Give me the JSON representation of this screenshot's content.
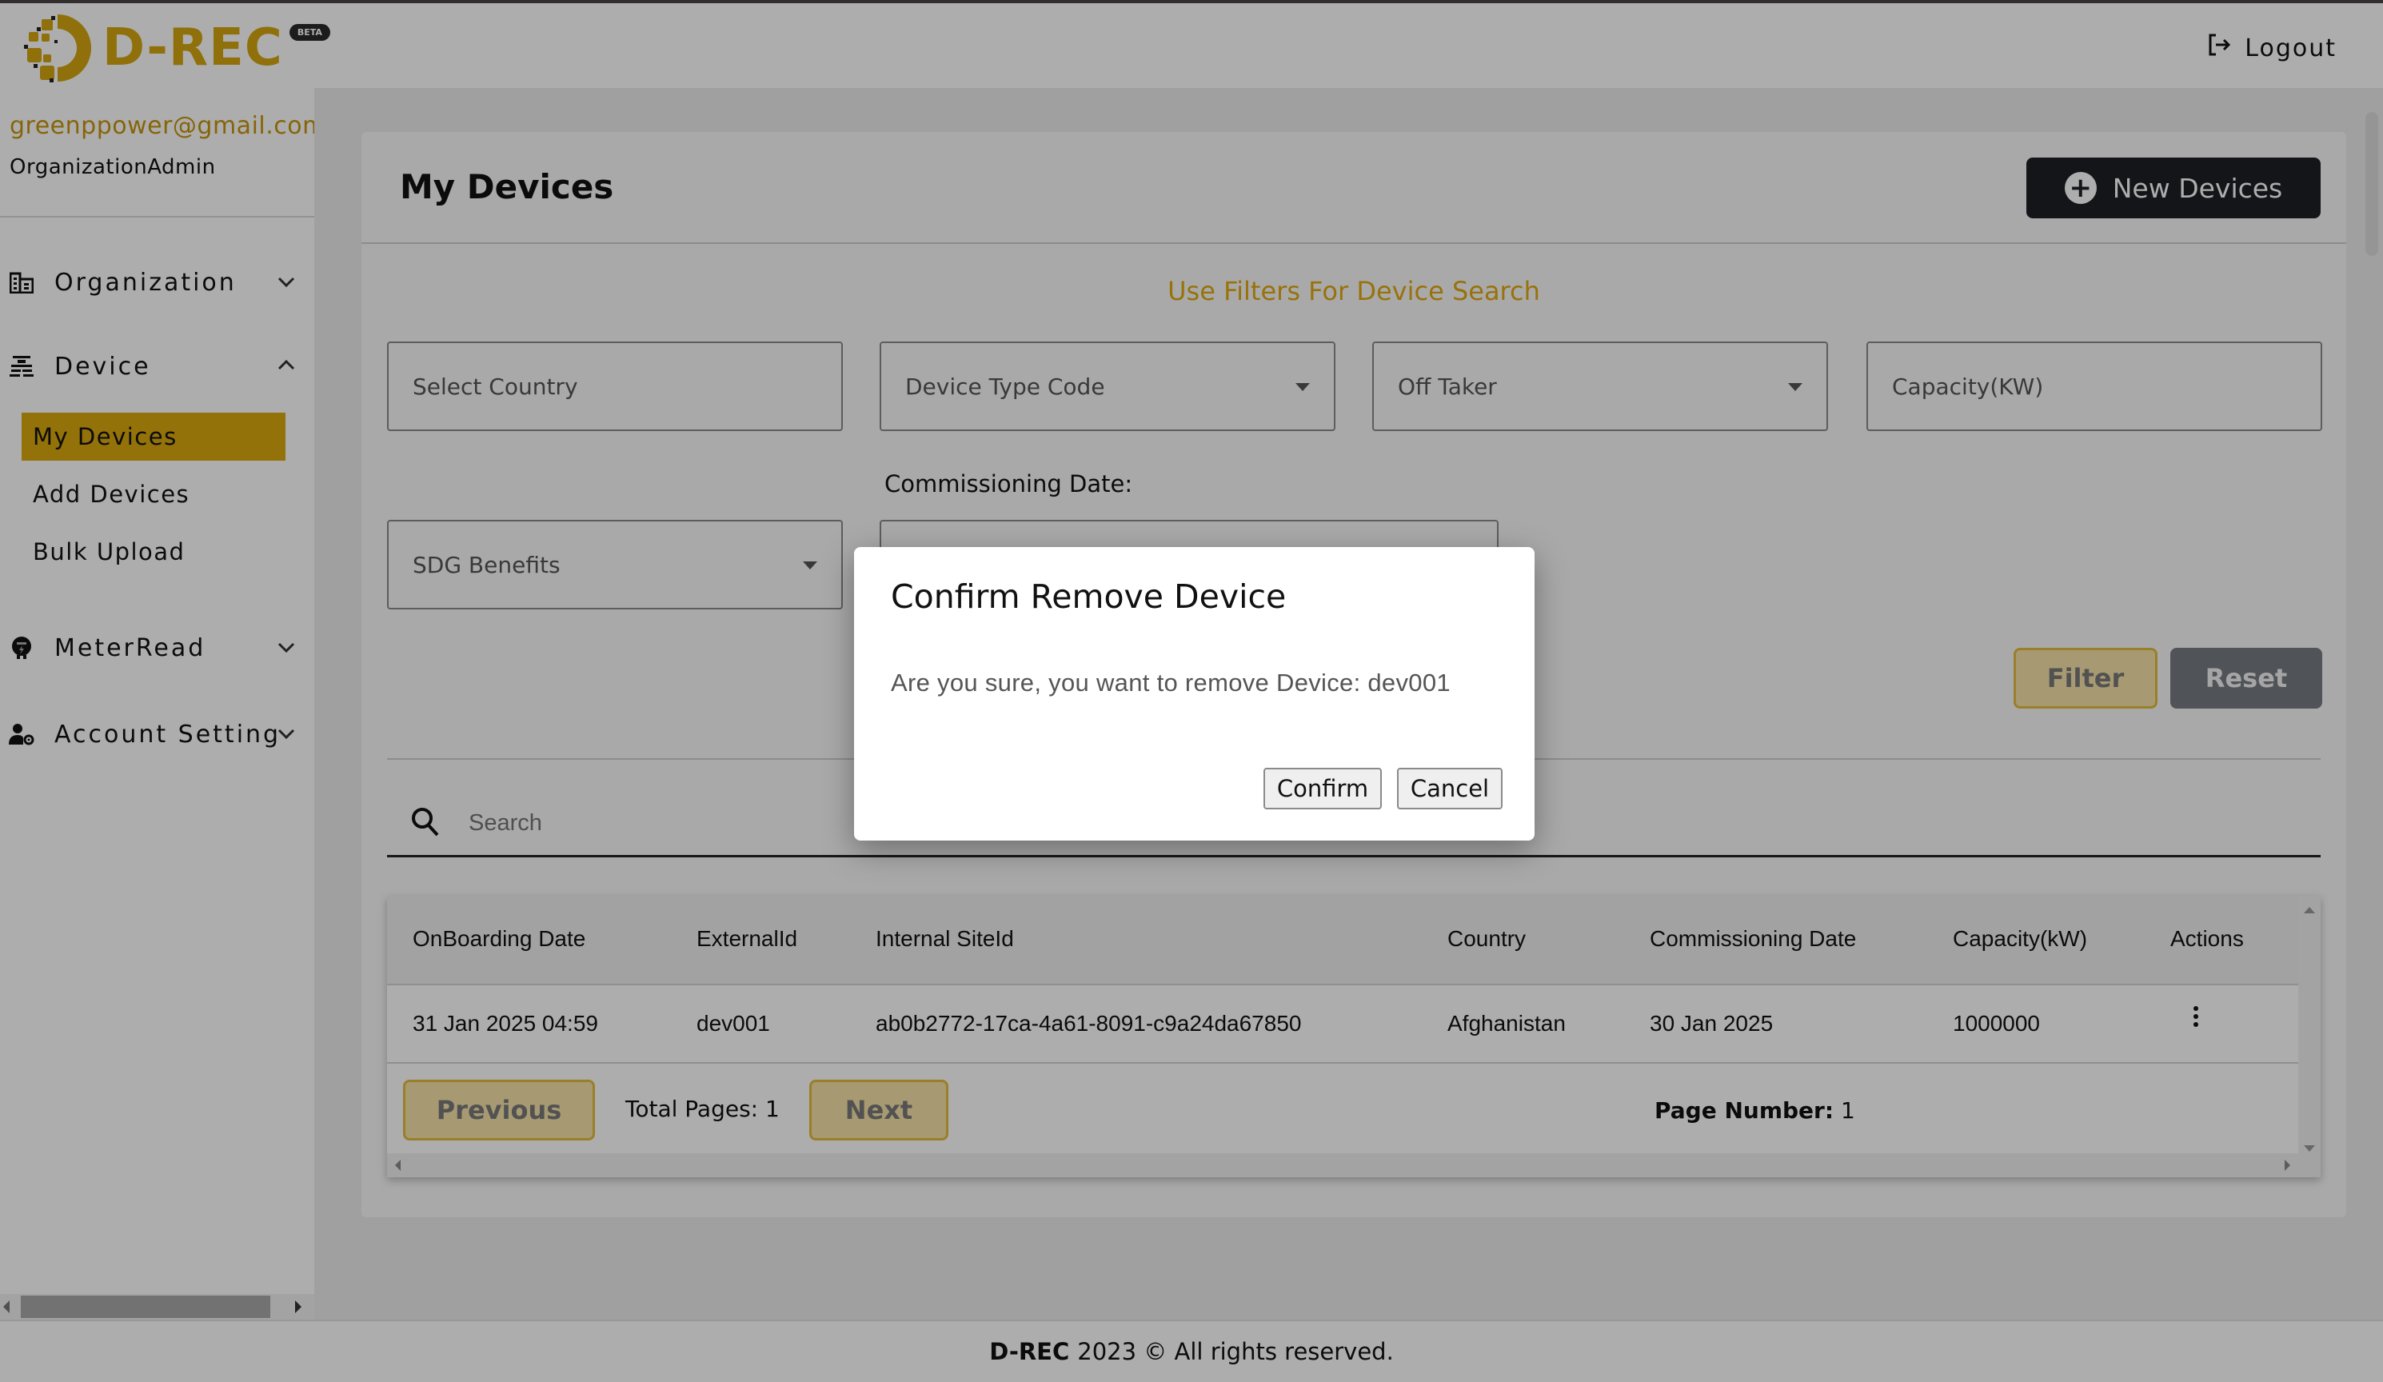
{
  "app": {
    "logo_text": "D-REC",
    "beta_badge": "BETA",
    "brand_color": "#d4a50f"
  },
  "header": {
    "logout_label": "Logout",
    "logout_icon": "logout-icon"
  },
  "user": {
    "email": "greenppower@gmail.com",
    "role": "OrganizationAdmin"
  },
  "sidebar": {
    "items": [
      {
        "label": "Organization",
        "icon": "building-icon",
        "expanded": false
      },
      {
        "label": "Device",
        "icon": "device-icon",
        "expanded": true,
        "children": [
          {
            "label": "My Devices",
            "active": true
          },
          {
            "label": "Add Devices",
            "active": false
          },
          {
            "label": "Bulk Upload",
            "active": false
          }
        ]
      },
      {
        "label": "MeterRead",
        "icon": "meter-icon",
        "expanded": false
      },
      {
        "label": "Account Setting",
        "icon": "user-gear-icon",
        "expanded": false
      }
    ]
  },
  "main": {
    "title": "My Devices",
    "new_button_label": "New Devices",
    "filters_title": "Use Filters For Device Search",
    "filters": {
      "country_placeholder": "Select Country",
      "device_type_placeholder": "Device Type Code",
      "off_taker_placeholder": "Off Taker",
      "capacity_placeholder": "Capacity(KW)",
      "sdg_placeholder": "SDG Benefits",
      "commissioning_date_label": "Commissioning Date:",
      "commissioning_date_value": ""
    },
    "filter_button": "Filter",
    "reset_button": "Reset",
    "search_placeholder": "Search"
  },
  "table": {
    "columns": [
      "OnBoarding Date",
      "ExternalId",
      "Internal SiteId",
      "Country",
      "Commissioning Date",
      "Capacity(kW)",
      "Actions"
    ],
    "rows": [
      {
        "onboarding_date": "31 Jan 2025 04:59",
        "external_id": "dev001",
        "internal_site_id": "ab0b2772-17ca-4a61-8091-c9a24da67850",
        "country": "Afghanistan",
        "commissioning_date": "30 Jan 2025",
        "capacity_kw": "1000000"
      }
    ],
    "pagination": {
      "previous_label": "Previous",
      "next_label": "Next",
      "total_pages_label": "Total Pages: 1",
      "page_number_label": "Page Number:",
      "page_number": "1"
    }
  },
  "footer": {
    "brand": "D-REC",
    "text": "2023 © All rights reserved."
  },
  "modal": {
    "title": "Confirm Remove Device",
    "message": "Are you sure, you want to remove Device: dev001",
    "confirm_label": "Confirm",
    "cancel_label": "Cancel"
  }
}
